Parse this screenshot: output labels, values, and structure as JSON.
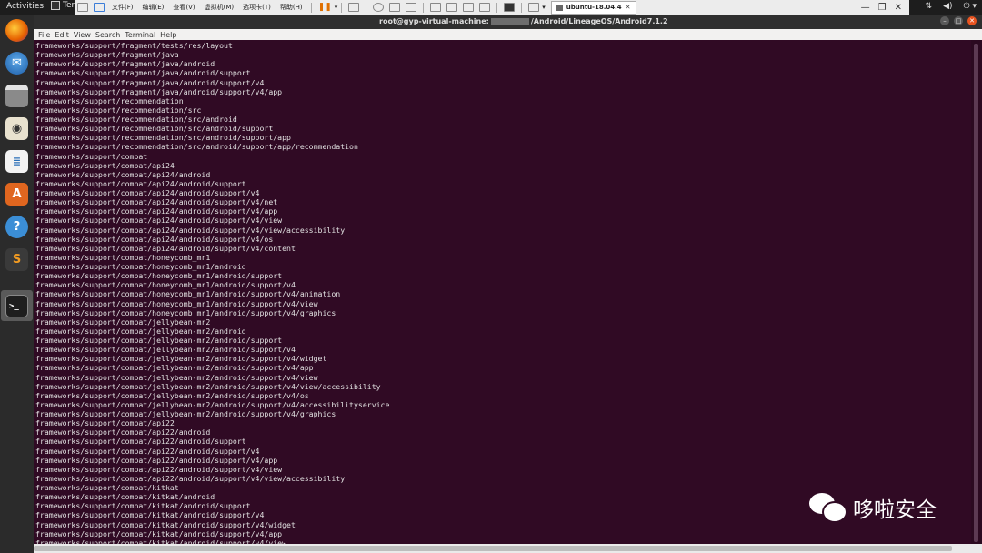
{
  "gnome_topbar": {
    "activities": "Activities",
    "app_name": "Ter"
  },
  "vmware_toolbar": {
    "menus": [
      "文件(F)",
      "编辑(E)",
      "查看(V)",
      "虚拟机(M)",
      "选项卡(T)",
      "帮助(H)"
    ],
    "vm_tab": "ubuntu-18.04.4"
  },
  "terminal": {
    "title_prefix": "root@gyp-virtual-machine:",
    "title_suffix": "/Android/LineageOS/Android7.1.2",
    "menu": [
      "File",
      "Edit",
      "View",
      "Search",
      "Terminal",
      "Help"
    ],
    "lines": [
      "frameworks/support/fragment/tests/res/layout",
      "frameworks/support/fragment/java",
      "frameworks/support/fragment/java/android",
      "frameworks/support/fragment/java/android/support",
      "frameworks/support/fragment/java/android/support/v4",
      "frameworks/support/fragment/java/android/support/v4/app",
      "frameworks/support/recommendation",
      "frameworks/support/recommendation/src",
      "frameworks/support/recommendation/src/android",
      "frameworks/support/recommendation/src/android/support",
      "frameworks/support/recommendation/src/android/support/app",
      "frameworks/support/recommendation/src/android/support/app/recommendation",
      "frameworks/support/compat",
      "frameworks/support/compat/api24",
      "frameworks/support/compat/api24/android",
      "frameworks/support/compat/api24/android/support",
      "frameworks/support/compat/api24/android/support/v4",
      "frameworks/support/compat/api24/android/support/v4/net",
      "frameworks/support/compat/api24/android/support/v4/app",
      "frameworks/support/compat/api24/android/support/v4/view",
      "frameworks/support/compat/api24/android/support/v4/view/accessibility",
      "frameworks/support/compat/api24/android/support/v4/os",
      "frameworks/support/compat/api24/android/support/v4/content",
      "frameworks/support/compat/honeycomb_mr1",
      "frameworks/support/compat/honeycomb_mr1/android",
      "frameworks/support/compat/honeycomb_mr1/android/support",
      "frameworks/support/compat/honeycomb_mr1/android/support/v4",
      "frameworks/support/compat/honeycomb_mr1/android/support/v4/animation",
      "frameworks/support/compat/honeycomb_mr1/android/support/v4/view",
      "frameworks/support/compat/honeycomb_mr1/android/support/v4/graphics",
      "frameworks/support/compat/jellybean-mr2",
      "frameworks/support/compat/jellybean-mr2/android",
      "frameworks/support/compat/jellybean-mr2/android/support",
      "frameworks/support/compat/jellybean-mr2/android/support/v4",
      "frameworks/support/compat/jellybean-mr2/android/support/v4/widget",
      "frameworks/support/compat/jellybean-mr2/android/support/v4/app",
      "frameworks/support/compat/jellybean-mr2/android/support/v4/view",
      "frameworks/support/compat/jellybean-mr2/android/support/v4/view/accessibility",
      "frameworks/support/compat/jellybean-mr2/android/support/v4/os",
      "frameworks/support/compat/jellybean-mr2/android/support/v4/accessibilityservice",
      "frameworks/support/compat/jellybean-mr2/android/support/v4/graphics",
      "frameworks/support/compat/api22",
      "frameworks/support/compat/api22/android",
      "frameworks/support/compat/api22/android/support",
      "frameworks/support/compat/api22/android/support/v4",
      "frameworks/support/compat/api22/android/support/v4/app",
      "frameworks/support/compat/api22/android/support/v4/view",
      "frameworks/support/compat/api22/android/support/v4/view/accessibility",
      "frameworks/support/compat/kitkat",
      "frameworks/support/compat/kitkat/android",
      "frameworks/support/compat/kitkat/android/support",
      "frameworks/support/compat/kitkat/android/support/v4",
      "frameworks/support/compat/kitkat/android/support/v4/widget",
      "frameworks/support/compat/kitkat/android/support/v4/app",
      "frameworks/support/compat/kitkat/android/support/v4/view"
    ]
  },
  "dock": {
    "icons": [
      "firefox-icon",
      "thunderbird-icon",
      "files-icon",
      "rhythmbox-icon",
      "writer-icon",
      "software-icon",
      "help-icon",
      "sublime-icon",
      "terminal-icon"
    ]
  },
  "watermark": {
    "text": "哆啦安全"
  },
  "colors": {
    "terminal_bg": "#300a24",
    "terminal_fg": "#e2e2e2",
    "accent": "#e95420"
  }
}
